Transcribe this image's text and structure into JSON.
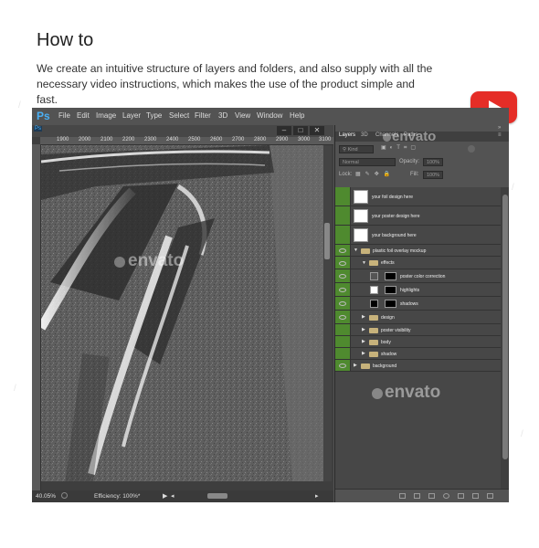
{
  "heading": "How to",
  "description": "We create an intuitive structure of layers and folders, and also supply with all the necessary video instructions, which makes the use of the product simple and fast.",
  "app": {
    "logo": "Ps",
    "menu": [
      "File",
      "Edit",
      "Image",
      "Layer",
      "Type",
      "Select",
      "Filter",
      "3D",
      "View",
      "Window",
      "Help"
    ],
    "doc_icon": "Ps",
    "ruler_numbers": [
      "1900",
      "2000",
      "2100",
      "2200",
      "2300",
      "2400",
      "2500",
      "2600",
      "2700",
      "2800",
      "2900",
      "3000",
      "3100"
    ],
    "zoom": "40.05%",
    "efficiency": "Efficiency: 100%*",
    "watermark": "envato"
  },
  "panel": {
    "tabs": [
      "Layers",
      "3D",
      "Channels",
      "Paths"
    ],
    "kind": "Kind",
    "blend_mode": "Normal",
    "opacity_label": "Opacity:",
    "opacity_value": "100%",
    "lock_label": "Lock:",
    "fill_label": "Fill:",
    "fill_value": "100%",
    "layers": [
      {
        "name": "your foil design here",
        "type": "smart",
        "indent": 0
      },
      {
        "name": "your poster design here",
        "type": "smart",
        "indent": 0
      },
      {
        "name": "your background here",
        "type": "smart",
        "indent": 0
      },
      {
        "name": "plastic foil overlay mockup",
        "type": "group-open",
        "indent": 0
      },
      {
        "name": "effects",
        "type": "group-open",
        "indent": 1
      },
      {
        "name": "poster color correction",
        "type": "adjust",
        "indent": 2
      },
      {
        "name": "highlights",
        "type": "masked",
        "indent": 2
      },
      {
        "name": "shadows",
        "type": "masked",
        "indent": 2
      },
      {
        "name": "design",
        "type": "group",
        "indent": 1
      },
      {
        "name": "poster visibility",
        "type": "group",
        "indent": 1
      },
      {
        "name": "body",
        "type": "group",
        "indent": 1
      },
      {
        "name": "shadow",
        "type": "group",
        "indent": 1
      },
      {
        "name": "background",
        "type": "group",
        "indent": 0
      }
    ]
  }
}
